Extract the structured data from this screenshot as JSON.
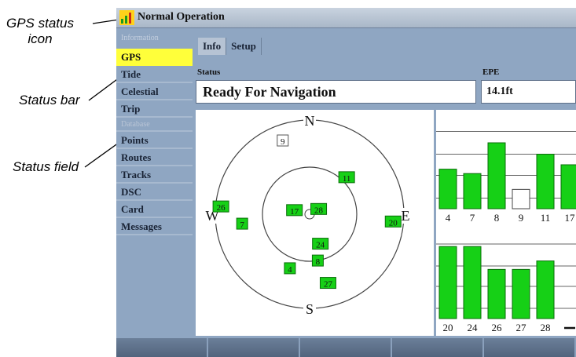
{
  "callouts": {
    "gps_status_icon": [
      "GPS status",
      "icon"
    ],
    "status_bar": "Status bar",
    "status_field": "Status field"
  },
  "titlebar": {
    "text": "Normal Operation"
  },
  "sidebar": {
    "header": "Information",
    "items": [
      {
        "label": "GPS",
        "active": true
      },
      {
        "label": "Tide"
      },
      {
        "label": "Celestial"
      },
      {
        "label": "Trip"
      },
      {
        "label": "Points"
      },
      {
        "label": "Routes"
      },
      {
        "label": "Tracks"
      },
      {
        "label": "DSC"
      },
      {
        "label": "Card"
      },
      {
        "label": "Messages"
      }
    ],
    "subheader": "Database"
  },
  "tabs": [
    {
      "label": "Info",
      "active": true
    },
    {
      "label": "Setup"
    }
  ],
  "status": {
    "label": "Status",
    "value": "Ready For Navigation"
  },
  "epe": {
    "label": "EPE",
    "value": "14.1ft"
  },
  "skyview": {
    "directions": {
      "n": "N",
      "e": "E",
      "s": "S",
      "w": "W"
    },
    "satellites": [
      {
        "id": "9",
        "az": 340,
        "el": 15,
        "locked": false
      },
      {
        "id": "11",
        "az": 45,
        "el": 40,
        "locked": true
      },
      {
        "id": "17",
        "az": 285,
        "el": 75,
        "locked": true
      },
      {
        "id": "28",
        "az": 60,
        "el": 80,
        "locked": true
      },
      {
        "id": "26",
        "az": 275,
        "el": 5,
        "locked": true
      },
      {
        "id": "7",
        "az": 262,
        "el": 25,
        "locked": true
      },
      {
        "id": "20",
        "az": 95,
        "el": 10,
        "locked": true
      },
      {
        "id": "24",
        "az": 160,
        "el": 60,
        "locked": true
      },
      {
        "id": "8",
        "az": 170,
        "el": 45,
        "locked": true
      },
      {
        "id": "4",
        "az": 200,
        "el": 35,
        "locked": true
      },
      {
        "id": "27",
        "az": 165,
        "el": 22,
        "locked": true
      }
    ]
  },
  "signal_bars": {
    "row1": [
      {
        "id": "4",
        "strength": 0.45,
        "locked": true
      },
      {
        "id": "7",
        "strength": 0.4,
        "locked": true
      },
      {
        "id": "8",
        "strength": 0.75,
        "locked": true
      },
      {
        "id": "9",
        "strength": 0.22,
        "locked": false
      },
      {
        "id": "11",
        "strength": 0.62,
        "locked": true
      },
      {
        "id": "17",
        "strength": 0.5,
        "locked": true
      }
    ],
    "row2": [
      {
        "id": "20",
        "strength": 0.85,
        "locked": true
      },
      {
        "id": "24",
        "strength": 0.85,
        "locked": true
      },
      {
        "id": "26",
        "strength": 0.58,
        "locked": true
      },
      {
        "id": "27",
        "strength": 0.58,
        "locked": true
      },
      {
        "id": "28",
        "strength": 0.68,
        "locked": true
      },
      {
        "id": "",
        "strength": 0.0,
        "locked": false
      }
    ]
  },
  "colors": {
    "locked": "#16d016",
    "unlocked": "#ffffff",
    "active_item": "#ffff3a",
    "screen_bg": "#8fa6c2"
  },
  "softkeys": 5
}
